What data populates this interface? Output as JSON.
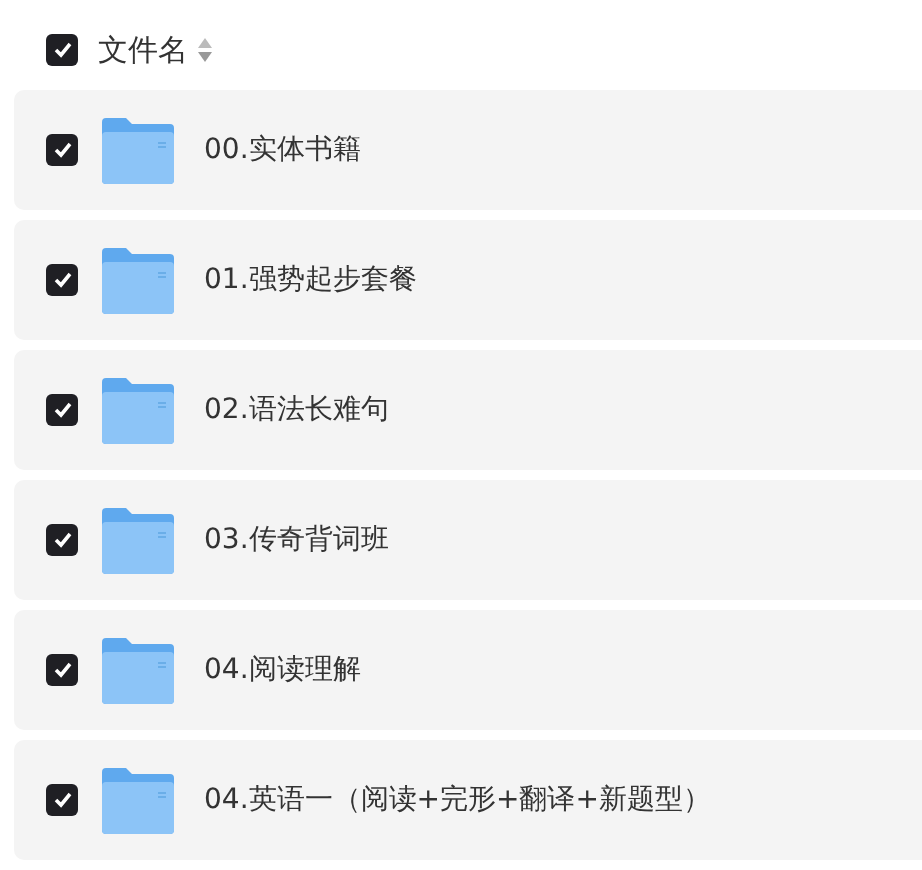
{
  "header": {
    "label": "文件名",
    "checked": true
  },
  "files": [
    {
      "name": "00.实体书籍",
      "checked": true
    },
    {
      "name": "01.强势起步套餐",
      "checked": true
    },
    {
      "name": "02.语法长难句",
      "checked": true
    },
    {
      "name": "03.传奇背词班",
      "checked": true
    },
    {
      "name": "04.阅读理解",
      "checked": true
    },
    {
      "name": "04.英语一（阅读+完形+翻译+新题型）",
      "checked": true
    }
  ]
}
